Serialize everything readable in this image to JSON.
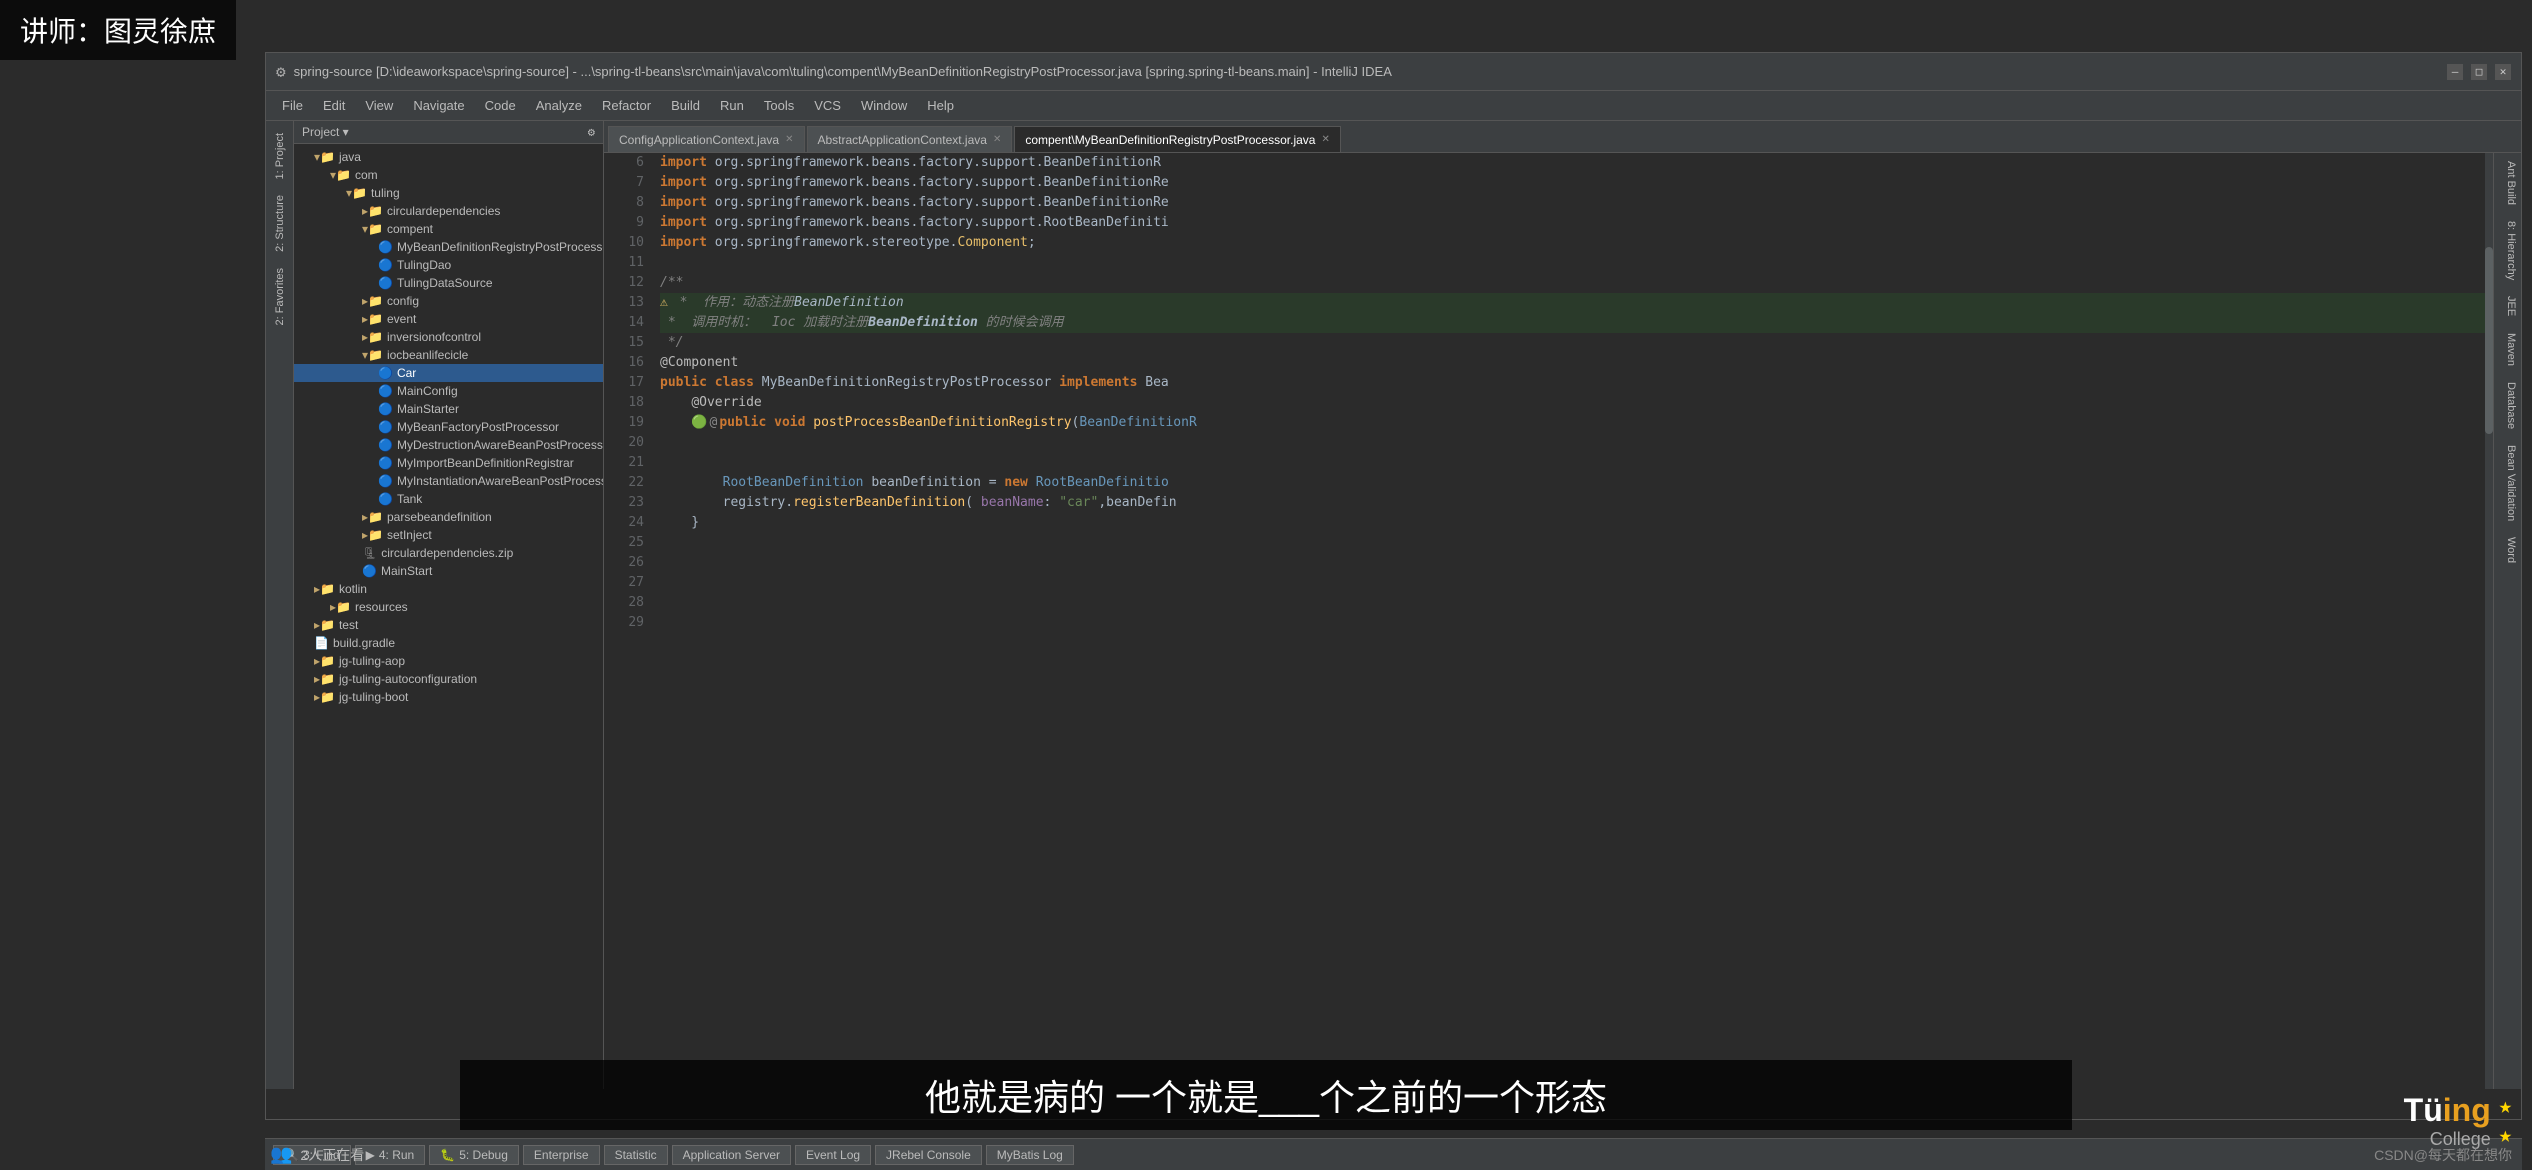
{
  "watermark": {
    "label": "讲师：图灵徐庶"
  },
  "title_bar": {
    "text": "spring-source [D:\\ideaworkspace\\spring-source] - ...\\spring-tl-beans\\src\\main\\java\\com\\tuling\\compent\\MyBeanDefinitionRegistryPostProcessor.java [spring.spring-tl-beans.main] - IntelliJ IDEA",
    "minimize": "—",
    "maximize": "□",
    "close": "✕"
  },
  "menu": {
    "items": [
      "File",
      "Edit",
      "View",
      "Navigate",
      "Code",
      "Analyze",
      "Refactor",
      "Build",
      "Run",
      "Tools",
      "VCS",
      "Window",
      "Help"
    ]
  },
  "tabs": [
    {
      "label": "ConfigApplicationContext.java",
      "active": false
    },
    {
      "label": "AbstractApplicationContext.java",
      "active": false
    },
    {
      "label": "compent\\MyBeanDefinitionRegistryPostProcessor.java",
      "active": true
    }
  ],
  "project_panel": {
    "title": "Project",
    "tree": [
      {
        "level": 0,
        "type": "folder",
        "label": "java",
        "expanded": true
      },
      {
        "level": 1,
        "type": "folder",
        "label": "com",
        "expanded": true
      },
      {
        "level": 2,
        "type": "folder",
        "label": "tuling",
        "expanded": true
      },
      {
        "level": 3,
        "type": "folder",
        "label": "circulardependencies",
        "expanded": false
      },
      {
        "level": 3,
        "type": "folder",
        "label": "compent",
        "expanded": true
      },
      {
        "level": 4,
        "type": "javaclass",
        "label": "MyBeanDefinitionRegistryPostProcessor"
      },
      {
        "level": 4,
        "type": "javaclass",
        "label": "TulingDao"
      },
      {
        "level": 4,
        "type": "javaclass",
        "label": "TulingDataSource"
      },
      {
        "level": 3,
        "type": "folder",
        "label": "config",
        "expanded": false
      },
      {
        "level": 3,
        "type": "folder",
        "label": "event",
        "expanded": false
      },
      {
        "level": 3,
        "type": "folder",
        "label": "inversionofcontrol",
        "expanded": false
      },
      {
        "level": 3,
        "type": "folder",
        "label": "iocbeanlifecicle",
        "expanded": true
      },
      {
        "level": 4,
        "type": "javaclass",
        "label": "Car",
        "selected": true
      },
      {
        "level": 4,
        "type": "javaclass",
        "label": "MainConfig"
      },
      {
        "level": 4,
        "type": "javaclass",
        "label": "MainStarter"
      },
      {
        "level": 4,
        "type": "javaclass",
        "label": "MyBeanFactoryPostProcessor"
      },
      {
        "level": 4,
        "type": "javaclass",
        "label": "MyDestructionAwareBeanPostProcessor"
      },
      {
        "level": 4,
        "type": "javaclass",
        "label": "MyImportBeanDefinitionRegistrar"
      },
      {
        "level": 4,
        "type": "javaclass",
        "label": "MyInstantiationAwareBeanPostProcessor"
      },
      {
        "level": 4,
        "type": "javaclass",
        "label": "Tank"
      },
      {
        "level": 3,
        "type": "folder",
        "label": "parsebeandefinition",
        "expanded": false
      },
      {
        "level": 3,
        "type": "folder",
        "label": "setInject",
        "expanded": false
      },
      {
        "level": 3,
        "type": "file",
        "label": "circulardependencies.zip"
      },
      {
        "level": 3,
        "type": "javaclass",
        "label": "MainStart"
      },
      {
        "level": 0,
        "type": "folder",
        "label": "kotlin",
        "expanded": false
      },
      {
        "level": 1,
        "type": "folder",
        "label": "resources",
        "expanded": false
      },
      {
        "level": 0,
        "type": "folder",
        "label": "test",
        "expanded": false
      },
      {
        "level": 0,
        "type": "file",
        "label": "build.gradle"
      },
      {
        "level": 0,
        "type": "folder",
        "label": "jg-tuling-aop",
        "expanded": false
      },
      {
        "level": 0,
        "type": "folder",
        "label": "jg-tuling-autoconfiguration",
        "expanded": false
      },
      {
        "level": 0,
        "type": "folder",
        "label": "jg-tuling-boot",
        "expanded": false
      }
    ]
  },
  "code": {
    "lines": [
      {
        "num": 6,
        "content": "import org.springframework.beans.factory.support.BeanDefinitionR",
        "highlight": false
      },
      {
        "num": 7,
        "content": "import org.springframework.beans.factory.support.BeanDefinitionRe",
        "highlight": false
      },
      {
        "num": 8,
        "content": "import org.springframework.beans.factory.support.BeanDefinitionRe",
        "highlight": false
      },
      {
        "num": 9,
        "content": "import org.springframework.beans.factory.support.RootBeanDefiniti",
        "highlight": false
      },
      {
        "num": 10,
        "content": "import org.springframework.stereotype.Component;",
        "highlight": false
      },
      {
        "num": 11,
        "content": "",
        "highlight": false
      },
      {
        "num": 12,
        "content": "/**",
        "highlight": false
      },
      {
        "num": 13,
        "content": " *  作用：动态注册BeanDefinition",
        "highlight": true
      },
      {
        "num": 14,
        "content": " *  调用时机：  Ioc 加载时注册BeanDefinition 的时候会调用",
        "highlight": true
      },
      {
        "num": 15,
        "content": " */",
        "highlight": false
      },
      {
        "num": 16,
        "content": "@Component",
        "highlight": false
      },
      {
        "num": 17,
        "content": "public class MyBeanDefinitionRegistryPostProcessor implements Bea",
        "highlight": false
      },
      {
        "num": 18,
        "content": "    @Override",
        "highlight": false
      },
      {
        "num": 19,
        "content": "    public void postProcessBeanDefinitionRegistry(BeanDefinitionR",
        "highlight": false
      },
      {
        "num": 20,
        "content": "",
        "highlight": false
      },
      {
        "num": 21,
        "content": "",
        "highlight": false
      },
      {
        "num": 22,
        "content": "        RootBeanDefinition beanDefinition = new RootBeanDefinitio",
        "highlight": false
      },
      {
        "num": 23,
        "content": "        registry.registerBeanDefinition( beanName: \"car\",beanDefin",
        "highlight": false
      },
      {
        "num": 24,
        "content": "    }",
        "highlight": false
      },
      {
        "num": 25,
        "content": "",
        "highlight": false
      },
      {
        "num": 26,
        "content": "",
        "highlight": false
      },
      {
        "num": 27,
        "content": "",
        "highlight": false
      },
      {
        "num": 28,
        "content": "",
        "highlight": false
      },
      {
        "num": 29,
        "content": "",
        "highlight": false
      }
    ]
  },
  "bottom_tabs": [
    {
      "label": "3: Find",
      "icon": "🔍"
    },
    {
      "label": "4: Run",
      "icon": "▶"
    },
    {
      "label": "5: Debug",
      "icon": "🐛"
    },
    {
      "label": "Enterprise",
      "active": false
    },
    {
      "label": "Statistic",
      "active": false
    },
    {
      "label": "Application Server",
      "active": false
    },
    {
      "label": "Event Log",
      "active": false
    },
    {
      "label": "JRebel Console",
      "active": false
    },
    {
      "label": "MyBatis Log",
      "active": false
    }
  ],
  "subtitle": "他就是病的 一个就是___个之前的一个形态",
  "status": {
    "viewers": "2人正在看"
  },
  "sidebar_left_tabs": [
    "1: Project",
    "2: Structure",
    "2: Favorites"
  ],
  "sidebar_right_tabs": [
    "Ant Build",
    "8: Hierarchy",
    "JEE",
    "Maven",
    "Database",
    "Bean Validation",
    "Word"
  ]
}
